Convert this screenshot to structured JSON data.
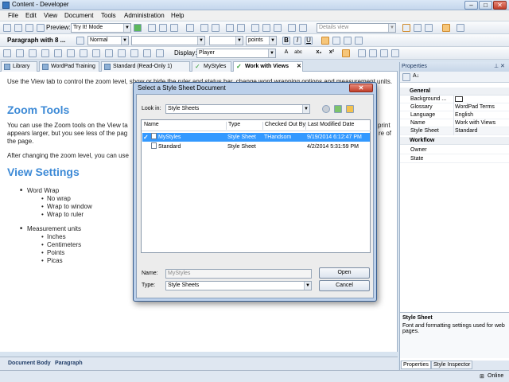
{
  "window": {
    "title": "Content - Developer"
  },
  "menu": [
    "File",
    "Edit",
    "View",
    "Document",
    "Tools",
    "Administration",
    "Help"
  ],
  "toolbar1": {
    "preview_label": "Preview:",
    "preview_value": "Try It! Mode",
    "details_view": "Details view"
  },
  "toolbar2": {
    "paragraph_style": "Paragraph with 8 ...",
    "style_value": "Normal",
    "size_unit": "points"
  },
  "toolbar3": {
    "display_label": "Display:",
    "display_value": "Player"
  },
  "tabs": [
    {
      "label": "Library"
    },
    {
      "label": "WordPad Training"
    },
    {
      "label": "Standard (Read-Only 1)"
    },
    {
      "label": "MyStyles"
    },
    {
      "label": "Work with Views"
    }
  ],
  "editor": {
    "intro": "Use the View tab to control the zoom level, show or hide the ruler and status bar, change word wrapping options and measurement units.",
    "zoom_heading": "Zoom Tools",
    "zoom_text": "You can use the Zoom tools on the View ta",
    "zoom_text_right1": "print",
    "zoom_text_right2": "re of",
    "zoom_text2": "appears larger, but you see less of the pag",
    "zoom_text3": "the page.",
    "after_text": "After changing the zoom level, you can use",
    "view_heading": "View Settings",
    "word_wrap": "Word Wrap",
    "wrap_items": [
      "No wrap",
      "Wrap to window",
      "Wrap to ruler"
    ],
    "measurement": "Measurement units",
    "unit_items": [
      "Inches",
      "Centimeters",
      "Points",
      "Picas"
    ]
  },
  "status": {
    "left1": "Document Body",
    "left2": "Paragraph",
    "online": "Online"
  },
  "properties": {
    "title": "Properties",
    "general": "General",
    "rows": [
      {
        "key": "Background ...",
        "value": ""
      },
      {
        "key": "Glossary",
        "value": "WordPad Terms"
      },
      {
        "key": "Language",
        "value": "English"
      },
      {
        "key": "Name",
        "value": "Work with Views"
      },
      {
        "key": "Style Sheet",
        "value": "Standard"
      }
    ],
    "workflow": "Workflow",
    "workflow_rows": [
      {
        "key": "Owner",
        "value": ""
      },
      {
        "key": "State",
        "value": ""
      }
    ],
    "desc_title": "Style Sheet",
    "desc_text": "Font and formatting settings used for web pages.",
    "tab_properties": "Properties",
    "tab_inspector": "Style Inspector"
  },
  "dialog": {
    "title": "Select a Style Sheet Document",
    "look_in_label": "Look in:",
    "look_in_value": "Style Sheets",
    "columns": [
      "Name",
      "Type",
      "Checked Out By",
      "Last Modified Date"
    ],
    "files": [
      {
        "name": "MyStyles",
        "type": "Style Sheet",
        "checked_out_by": "THandsom",
        "modified": "9/19/2014 6:12:47 PM",
        "selected": true
      },
      {
        "name": "Standard",
        "type": "Style Sheet",
        "checked_out_by": "",
        "modified": "4/2/2014 5:31:59 PM",
        "selected": false
      }
    ],
    "name_label": "Name:",
    "name_placeholder": "MyStyles",
    "type_label": "Type:",
    "type_value": "Style Sheets",
    "open_label": "Open",
    "cancel_label": "Cancel"
  }
}
